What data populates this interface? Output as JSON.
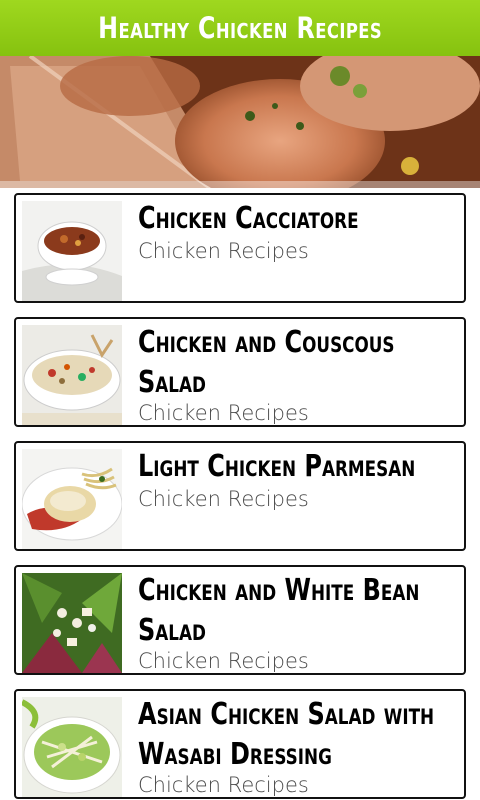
{
  "header": {
    "title": "Healthy Chicken Recipes"
  },
  "recipes": [
    {
      "title": "Chicken Cacciatore",
      "subtitle": "Chicken Recipes"
    },
    {
      "title": "Chicken and Couscous Salad",
      "subtitle": "Chicken Recipes"
    },
    {
      "title": "Light Chicken Parmesan",
      "subtitle": "Chicken Recipes"
    },
    {
      "title": "Chicken and White Bean Salad",
      "subtitle": "Chicken Recipes"
    },
    {
      "title": "Asian Chicken Salad with Wasabi Dressing",
      "subtitle": "Chicken Recipes"
    }
  ],
  "colors": {
    "header_bg": "#8ecb14",
    "card_border": "#111111",
    "subtitle": "#4a4a4a"
  }
}
